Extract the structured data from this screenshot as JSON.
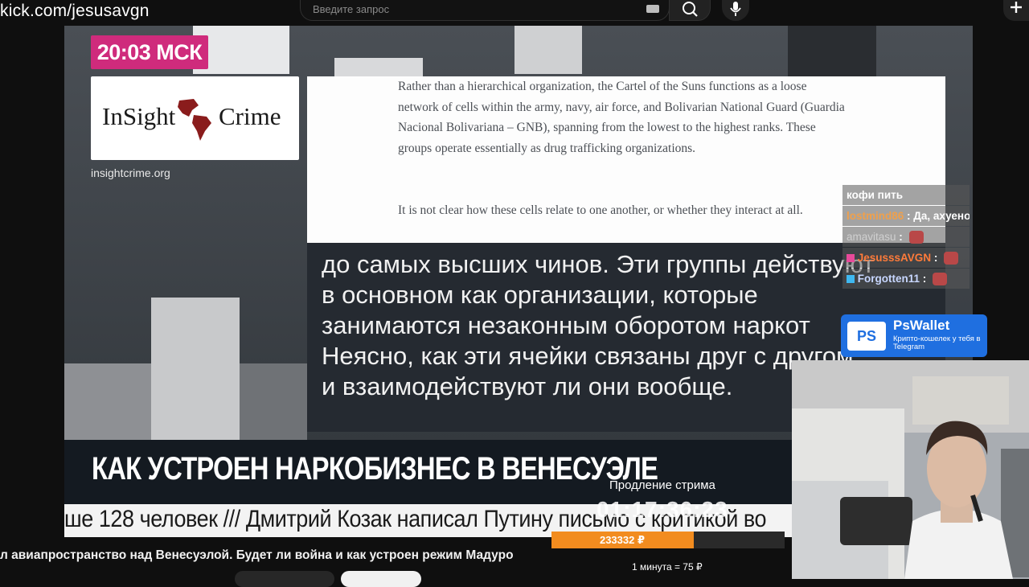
{
  "browser": {
    "url": "kick.com/jesusavgn",
    "search_placeholder": "Введите запрос"
  },
  "broadcast": {
    "clock": "20:03 МСК",
    "logo_left": "InSight",
    "logo_right": "Crime",
    "site_url": "insightcrime.org",
    "article_para_1": "Rather than a hierarchical organization, the Cartel of the Suns functions as a loose network of cells within the army, navy, air force, and Bolivarian National Guard (Guardia Nacional Bolivariana – GNB), spanning from the lowest to the highest ranks. These groups operate essentially as drug trafficking organizations.",
    "article_para_2": "It is not clear how these cells relate to one another, or whether they interact at all.",
    "subtitle": "до самых высших чинов. Эти группы действуют\nв основном как организации, которые\nзанимаются незаконным оборотом наркот\nНеясно, как эти ячейки связаны друг с другом\nи взаимодействуют ли они вообще.",
    "headline": "КАК УСТРОЕН НАРКОБИЗНЕС В ВЕНЕСУЭЛЕ",
    "ticker": "ше 128 человек   ///   Дмитрий Козак написал Путину письмо с критикой во"
  },
  "chat": {
    "messages": [
      {
        "user": "",
        "text": "кофи пить",
        "color": "#ffffff"
      },
      {
        "user": "lostmind86",
        "text": ": Да, ахуено.",
        "color": "#f0a04b"
      },
      {
        "user": "amavitasu",
        "text": ":",
        "color": "#d0d0d0"
      },
      {
        "user": "JesusssAVGN",
        "text": ":",
        "color": "#ff7b3a"
      },
      {
        "user": "Forgotten11",
        "text": ":",
        "color": "#c8d7ff"
      }
    ]
  },
  "sponsor": {
    "badge": "PS",
    "title": "PsWallet",
    "subtitle": "Крипто-кошелек у тебя в Telegram"
  },
  "subathon": {
    "label": "Продление стрима",
    "timer": "01:17:36:23",
    "progress_amount": "233332 ₽",
    "progress_fraction": 0.61,
    "rate": "1 минута = 75 ₽"
  },
  "video": {
    "title": "л авиапространство над Венесуэлой. Будет ли война и как устроен режим Мадуро"
  },
  "colors": {
    "clock_badge": "#cf2b7c",
    "progress_fill": "#f28c1f",
    "sponsor_blue": "#1f6fe0"
  }
}
